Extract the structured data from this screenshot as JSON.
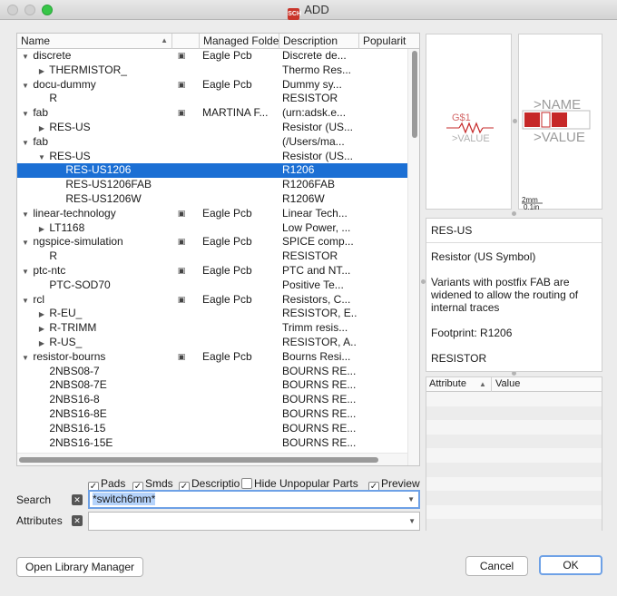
{
  "window": {
    "title": "ADD",
    "app_icon_text": "SCH"
  },
  "table": {
    "columns": {
      "name": "Name",
      "managed_folder": "Managed Folde",
      "description": "Description",
      "popularity": "Popularit"
    },
    "rows": [
      {
        "indent": 0,
        "arrow": "▼",
        "name": "discrete",
        "lock": true,
        "mf": "Eagle Pcb",
        "desc": "Discrete de..."
      },
      {
        "indent": 1,
        "arrow": "▶",
        "name": "THERMISTOR_",
        "lock": false,
        "mf": "",
        "desc": "Thermo Res..."
      },
      {
        "indent": 0,
        "arrow": "▼",
        "name": "docu-dummy",
        "lock": true,
        "mf": "Eagle Pcb",
        "desc": "Dummy sy..."
      },
      {
        "indent": 1,
        "arrow": "",
        "name": "R",
        "lock": false,
        "mf": "",
        "desc": "RESISTOR"
      },
      {
        "indent": 0,
        "arrow": "▼",
        "name": "fab",
        "lock": true,
        "mf": "MARTINA F...",
        "desc": "(urn:adsk.e..."
      },
      {
        "indent": 1,
        "arrow": "▶",
        "name": "RES-US",
        "lock": false,
        "mf": "",
        "desc": "Resistor (US..."
      },
      {
        "indent": 0,
        "arrow": "▼",
        "name": "fab",
        "lock": false,
        "mf": "",
        "desc": "(/Users/ma..."
      },
      {
        "indent": 1,
        "arrow": "▼",
        "name": "RES-US",
        "lock": false,
        "mf": "",
        "desc": "Resistor (US..."
      },
      {
        "indent": 2,
        "arrow": "",
        "name": "RES-US1206",
        "lock": false,
        "mf": "",
        "desc": "R1206",
        "selected": true
      },
      {
        "indent": 2,
        "arrow": "",
        "name": "RES-US1206FAB",
        "lock": false,
        "mf": "",
        "desc": "R1206FAB"
      },
      {
        "indent": 2,
        "arrow": "",
        "name": "RES-US1206W",
        "lock": false,
        "mf": "",
        "desc": "R1206W"
      },
      {
        "indent": 0,
        "arrow": "▼",
        "name": "linear-technology",
        "lock": true,
        "mf": "Eagle Pcb",
        "desc": "Linear Tech..."
      },
      {
        "indent": 1,
        "arrow": "▶",
        "name": "LT1168",
        "lock": false,
        "mf": "",
        "desc": "Low Power, ..."
      },
      {
        "indent": 0,
        "arrow": "▼",
        "name": "ngspice-simulation",
        "lock": true,
        "mf": "Eagle Pcb",
        "desc": "SPICE comp..."
      },
      {
        "indent": 1,
        "arrow": "",
        "name": "R",
        "lock": false,
        "mf": "",
        "desc": "RESISTOR"
      },
      {
        "indent": 0,
        "arrow": "▼",
        "name": "ptc-ntc",
        "lock": true,
        "mf": "Eagle Pcb",
        "desc": "PTC and NT..."
      },
      {
        "indent": 1,
        "arrow": "",
        "name": "PTC-SOD70",
        "lock": false,
        "mf": "",
        "desc": "Positive Te..."
      },
      {
        "indent": 0,
        "arrow": "▼",
        "name": "rcl",
        "lock": true,
        "mf": "Eagle Pcb",
        "desc": "Resistors, C..."
      },
      {
        "indent": 1,
        "arrow": "▶",
        "name": "R-EU_",
        "lock": false,
        "mf": "",
        "desc": "RESISTOR, E..."
      },
      {
        "indent": 1,
        "arrow": "▶",
        "name": "R-TRIMM",
        "lock": false,
        "mf": "",
        "desc": "Trimm resis..."
      },
      {
        "indent": 1,
        "arrow": "▶",
        "name": "R-US_",
        "lock": false,
        "mf": "",
        "desc": "RESISTOR, A..."
      },
      {
        "indent": 0,
        "arrow": "▼",
        "name": "resistor-bourns",
        "lock": true,
        "mf": "Eagle Pcb",
        "desc": "Bourns Resi..."
      },
      {
        "indent": 1,
        "arrow": "",
        "name": "2NBS08-7",
        "lock": false,
        "mf": "",
        "desc": "BOURNS RE..."
      },
      {
        "indent": 1,
        "arrow": "",
        "name": "2NBS08-7E",
        "lock": false,
        "mf": "",
        "desc": "BOURNS RE..."
      },
      {
        "indent": 1,
        "arrow": "",
        "name": "2NBS16-8",
        "lock": false,
        "mf": "",
        "desc": "BOURNS RE..."
      },
      {
        "indent": 1,
        "arrow": "",
        "name": "2NBS16-8E",
        "lock": false,
        "mf": "",
        "desc": "BOURNS RE..."
      },
      {
        "indent": 1,
        "arrow": "",
        "name": "2NBS16-15",
        "lock": false,
        "mf": "",
        "desc": "BOURNS RE..."
      },
      {
        "indent": 1,
        "arrow": "",
        "name": "2NBS16-15E",
        "lock": false,
        "mf": "",
        "desc": "BOURNS RE..."
      }
    ]
  },
  "preview": {
    "symbol": {
      "name": "G$1",
      "value": ">VALUE"
    },
    "package": {
      "name": ">NAME",
      "value": ">VALUE",
      "scale": "2mm",
      "scale_sub": "0.1in"
    }
  },
  "info": {
    "title": "RES-US",
    "subtitle": "Resistor (US Symbol)",
    "text": "Variants with postfix FAB are widened to allow the routing of internal traces",
    "footprint": "Footprint: R1206",
    "value": "RESISTOR"
  },
  "attributes": {
    "col_attribute": "Attribute",
    "col_value": "Value"
  },
  "filters": [
    {
      "label": "Pads",
      "checked": true
    },
    {
      "label": "Smds",
      "checked": true
    },
    {
      "label": "Descriptio",
      "checked": true
    },
    {
      "label": "Hide Unpopular Parts",
      "checked": false
    },
    {
      "label": "Preview",
      "checked": true
    }
  ],
  "search": {
    "label": "Search",
    "value": "*switch6mm*"
  },
  "attr_filter": {
    "label": "Attributes",
    "value": ""
  },
  "buttons": {
    "library_manager": "Open Library Manager",
    "cancel": "Cancel",
    "ok": "OK"
  },
  "colors": {
    "selection": "#1b6fd4",
    "focus_ring": "#6ea1e6",
    "symbol_red": "#c62828"
  }
}
